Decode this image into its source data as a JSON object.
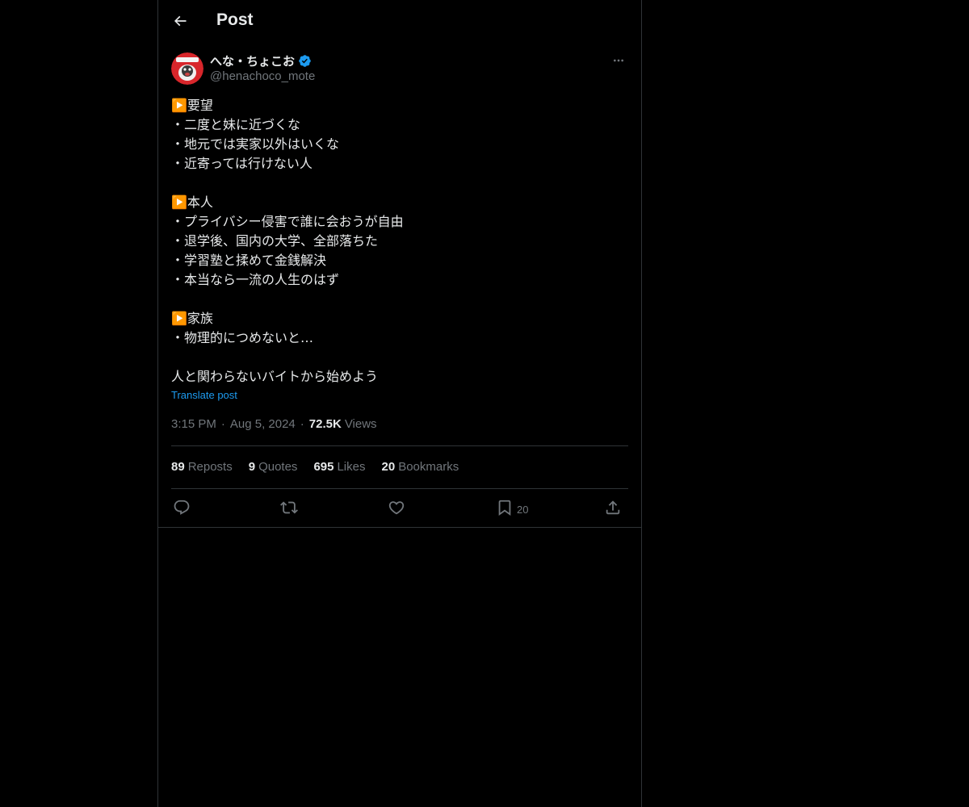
{
  "header": {
    "title": "Post",
    "back_icon": "arrow-left-icon"
  },
  "author": {
    "name": "へな・ちょこお",
    "handle": "@henachoco_mote",
    "verified_icon": "verified-badge-icon",
    "more_icon": "more-horizontal-icon"
  },
  "post": {
    "lines": [
      "▶️要望",
      "・二度と妹に近づくな",
      "・地元では実家以外はいくな",
      "・近寄っては行けない人",
      "",
      "▶️本人",
      "・プライバシー侵害で誰に会おうが自由",
      "・退学後、国内の大学、全部落ちた",
      "・学習塾と揉めて金銭解決",
      "・本当なら一流の人生のはず",
      "",
      "▶️家族",
      "・物理的につめないと…",
      "",
      "人と関わらないバイトから始めよう"
    ],
    "translate_label": "Translate post"
  },
  "meta": {
    "time": "3:15 PM",
    "separator": "·",
    "date": "Aug 5, 2024",
    "views_count": "72.5K",
    "views_label": "Views"
  },
  "stats": {
    "reposts_count": "89",
    "reposts_label": "Reposts",
    "quotes_count": "9",
    "quotes_label": "Quotes",
    "likes_count": "695",
    "likes_label": "Likes",
    "bookmarks_count": "20",
    "bookmarks_label": "Bookmarks"
  },
  "actions": {
    "reply_icon": "reply-icon",
    "repost_icon": "repost-icon",
    "like_icon": "heart-icon",
    "bookmark_icon": "bookmark-icon",
    "bookmark_count": "20",
    "share_icon": "share-icon"
  },
  "colors": {
    "background": "#000000",
    "text": "#e7e9ea",
    "secondary": "#71767b",
    "accent": "#1d9bf0",
    "border": "#2f3336"
  }
}
